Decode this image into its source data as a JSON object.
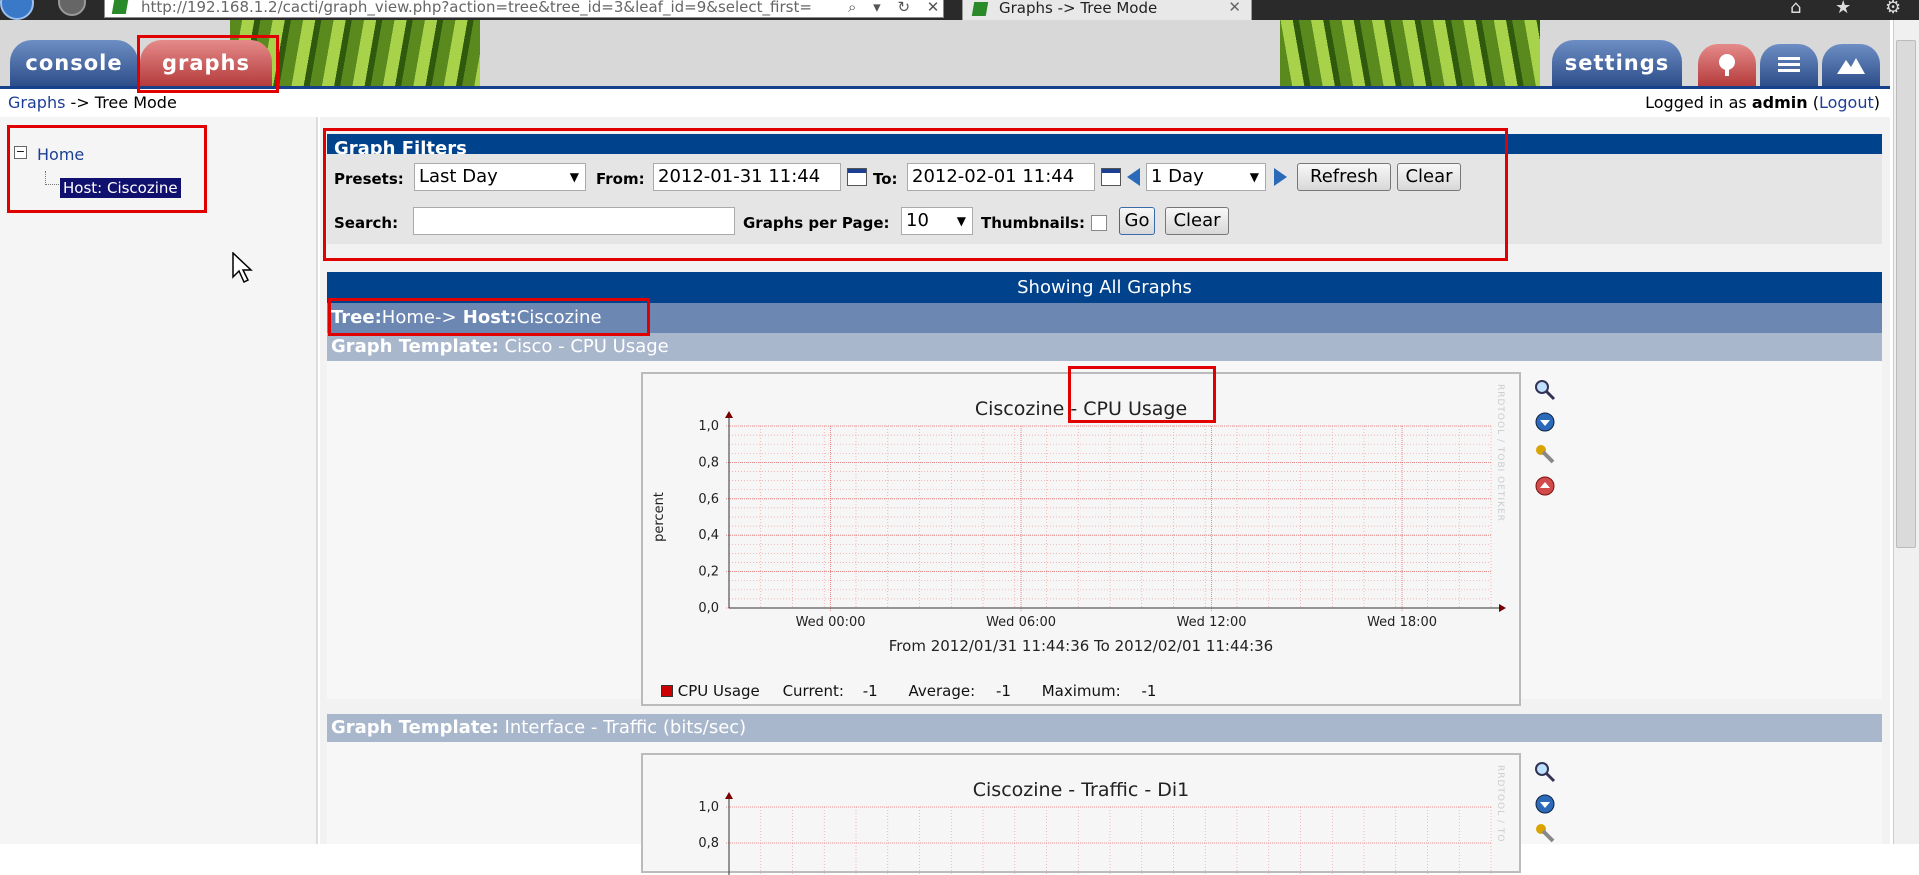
{
  "browser": {
    "url": "http://192.168.1.2/cacti/graph_view.php?action=tree&tree_id=3&leaf_id=9&select_first=",
    "addr_icons": "⌕ ▾ ↻ ✕",
    "tab_title": "Graphs -> Tree Mode",
    "tab_close": "✕",
    "window_icons": "⌂ ★ ⚙"
  },
  "nav": {
    "console": "console",
    "graphs": "graphs",
    "settings": "settings"
  },
  "breadcrumb": {
    "link": "Graphs",
    "rest": " -> Tree Mode"
  },
  "login": {
    "prefix": "Logged in as ",
    "user": "admin",
    "open": " (",
    "logout": "Logout",
    "close": ")"
  },
  "tree": {
    "expander": "−",
    "home": "Home",
    "host": "Host: Ciscozine"
  },
  "filters": {
    "title": "Graph Filters",
    "presets_label": "Presets:",
    "presets_value": "Last Day",
    "from_label": "From:",
    "from_value": "2012-01-31 11:44",
    "to_label": "To:",
    "to_value": "2012-02-01 11:44",
    "span_value": "1 Day",
    "refresh": "Refresh",
    "clear": "Clear",
    "search_label": "Search:",
    "search_value": "",
    "gpp_label": "Graphs per Page:",
    "gpp_value": "10",
    "thumbs_label": "Thumbnails:",
    "go": "Go",
    "clear2": "Clear"
  },
  "listing": {
    "showing": "Showing All Graphs",
    "tree_key": "Tree:",
    "tree_val": "Home->",
    "host_key": " Host:",
    "host_val": "Ciscozine"
  },
  "graph1": {
    "template_key": "Graph Template:",
    "template_val": " Cisco - CPU Usage",
    "title": "Ciscozine - CPU Usage",
    "ylabel": "percent",
    "watermark": "RRDTOOL / TOBI OETIKER",
    "ticks_y": [
      "1,0",
      "0,8",
      "0,6",
      "0,4",
      "0,2",
      "0,0"
    ],
    "ticks_x": [
      "Wed 00:00",
      "Wed 06:00",
      "Wed 12:00",
      "Wed 18:00"
    ],
    "range_text": "From 2012/01/31 11:44:36 To 2012/02/01 11:44:36",
    "legend_name": "CPU Usage",
    "legend_current_label": "Current:",
    "legend_current": "-1",
    "legend_avg_label": "Average:",
    "legend_avg": "-1",
    "legend_max_label": "Maximum:",
    "legend_max": "-1",
    "series_color": "#cc0000"
  },
  "graph2": {
    "template_key": "Graph Template:",
    "template_val": " Interface - Traffic (bits/sec)",
    "title": "Ciscozine - Traffic - Di1",
    "watermark": "RRDTOOL / TO",
    "ticks_y": [
      "1,0",
      "0,8"
    ]
  },
  "colors": {
    "header_blue": "#00438c",
    "link_blue": "#1c3f94",
    "highlight_red": "#e00000"
  }
}
